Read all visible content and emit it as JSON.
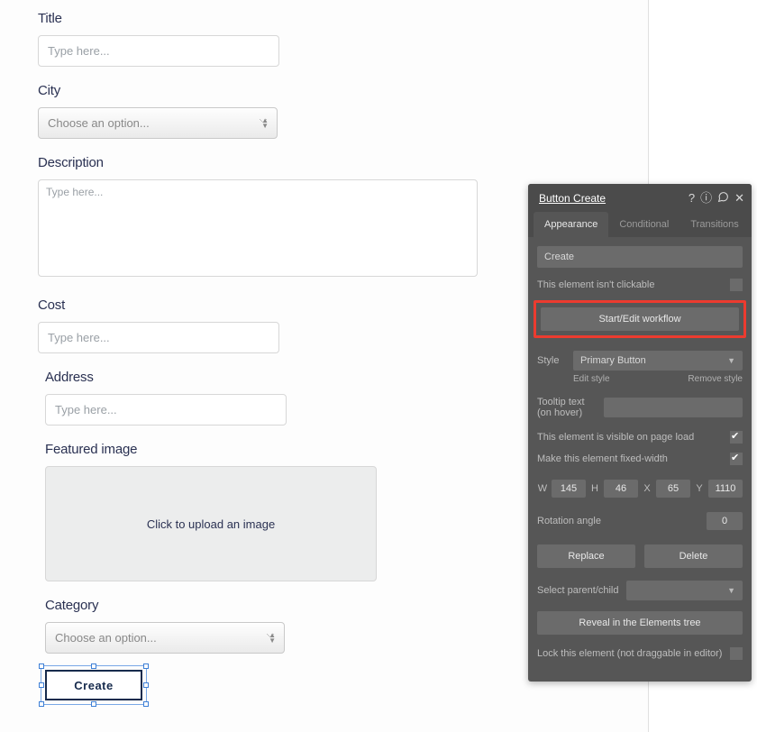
{
  "form": {
    "title": {
      "label": "Title",
      "placeholder": "Type here..."
    },
    "city": {
      "label": "City",
      "placeholder": "Choose an option..."
    },
    "description": {
      "label": "Description",
      "placeholder": "Type here..."
    },
    "cost": {
      "label": "Cost",
      "placeholder": "Type here..."
    },
    "address": {
      "label": "Address",
      "placeholder": "Type here..."
    },
    "featured_image": {
      "label": "Featured image",
      "cta": "Click to upload an image"
    },
    "category": {
      "label": "Category",
      "placeholder": "Choose an option..."
    },
    "create_button": "Create"
  },
  "inspector": {
    "title": "Button Create",
    "tabs": {
      "appearance": "Appearance",
      "conditional": "Conditional",
      "transitions": "Transitions"
    },
    "text_value": "Create",
    "not_clickable_label": "This element isn't clickable",
    "workflow_btn": "Start/Edit workflow",
    "style_label": "Style",
    "style_value": "Primary Button",
    "edit_style": "Edit style",
    "remove_style": "Remove style",
    "tooltip_label": "Tooltip text (on hover)",
    "tooltip_value": "",
    "visible_label": "This element is visible on page load",
    "visible_checked": true,
    "fixed_width_label": "Make this element fixed-width",
    "fixed_width_checked": true,
    "coords": {
      "w_label": "W",
      "w": "145",
      "h_label": "H",
      "h": "46",
      "x_label": "X",
      "x": "65",
      "y_label": "Y",
      "y": "1110"
    },
    "rotation_label": "Rotation angle",
    "rotation_value": "0",
    "replace_btn": "Replace",
    "delete_btn": "Delete",
    "select_parent_label": "Select parent/child",
    "reveal_btn": "Reveal in the Elements tree",
    "lock_label": "Lock this element (not draggable in editor)"
  }
}
